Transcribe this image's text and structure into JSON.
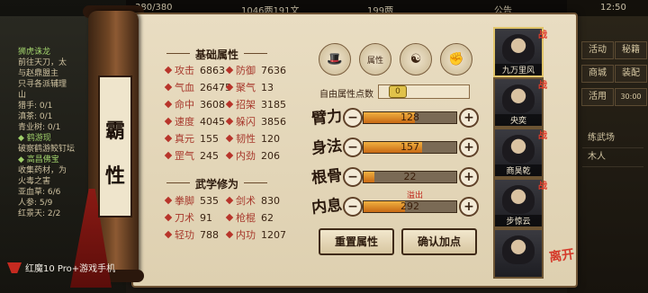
{
  "hud": {
    "stamina": "380/380",
    "copper": "1046两191文",
    "silver": "199两",
    "announce": "公告",
    "time": "12:50"
  },
  "quests": [
    {
      "title": "狮虎诛龙",
      "lines": [
        "前往天刀，太",
        "与赵鼎盟主",
        "只寻各派辅理",
        "山"
      ]
    },
    {
      "title": "",
      "lines": [
        "猎手: 0/1",
        "滇茶: 0/1",
        "青业树: 0/1"
      ]
    },
    {
      "title": "◆ 鹤游现",
      "lines": [
        "破察鹤游鲛钉坛"
      ]
    },
    {
      "title": "◆ 高昌佛宝",
      "lines": [
        "收集药材，为",
        "火毒之害"
      ]
    },
    {
      "title": "",
      "lines": [
        "亚血草: 6/6",
        "人参: 5/9",
        "红景天: 2/2"
      ]
    }
  ],
  "right_menu": [
    "活动",
    "秘籍",
    "商城",
    "装配",
    "活用"
  ],
  "right_menu_counts": [
    "",
    "",
    "",
    "",
    "30:00"
  ],
  "side_list": [
    "练武场",
    "木人"
  ],
  "character_name": [
    "霸",
    "性"
  ],
  "base_attr": {
    "title": "基础属性",
    "rows": [
      {
        "label": "攻击",
        "value": "6863"
      },
      {
        "label": "防御",
        "value": "7636"
      },
      {
        "label": "气血",
        "value": "26475"
      },
      {
        "label": "聚气",
        "value": "13"
      },
      {
        "label": "命中",
        "value": "3608"
      },
      {
        "label": "招架",
        "value": "3185"
      },
      {
        "label": "速度",
        "value": "4045"
      },
      {
        "label": "躲闪",
        "value": "3856"
      },
      {
        "label": "真元",
        "value": "155"
      },
      {
        "label": "韧性",
        "value": "120"
      },
      {
        "label": "罡气",
        "value": "245"
      },
      {
        "label": "内劲",
        "value": "206"
      }
    ]
  },
  "martial": {
    "title": "武学修为",
    "rows": [
      {
        "label": "拳脚",
        "value": "535"
      },
      {
        "label": "剑术",
        "value": "830"
      },
      {
        "label": "刀术",
        "value": "91"
      },
      {
        "label": "枪棍",
        "value": "62"
      },
      {
        "label": "轻功",
        "value": "788"
      },
      {
        "label": "内功",
        "value": "1207"
      }
    ]
  },
  "icons": [
    "hat-scholar-icon",
    "scroll-book-icon",
    "taichi-icon",
    "fist-icon"
  ],
  "icon_glyphs": [
    "🎩",
    "属性",
    "☯",
    "✊"
  ],
  "free_points": {
    "label": "自由属性点数",
    "value": "0"
  },
  "stats": [
    {
      "label": "臂力",
      "value": "128",
      "fill": 0.55,
      "overflow": ""
    },
    {
      "label": "身法",
      "value": "157",
      "fill": 0.63,
      "overflow": ""
    },
    {
      "label": "根骨",
      "value": "22",
      "fill": 0.12,
      "overflow": ""
    },
    {
      "label": "内息",
      "value": "292",
      "fill": 0.45,
      "overflow": "溢出"
    }
  ],
  "buttons": {
    "reset": "重置属性",
    "confirm": "确认加点"
  },
  "characters": [
    {
      "name": "九万里风",
      "tag": "战",
      "active": true
    },
    {
      "name": "央奕",
      "tag": "战",
      "active": false
    },
    {
      "name": "商昊乾",
      "tag": "战",
      "active": false
    },
    {
      "name": "步惊云",
      "tag": "战",
      "active": false
    },
    {
      "name": "",
      "tag": "",
      "active": false
    }
  ],
  "realm_tag": "离开",
  "watermark": "红魔10 Pro+游戏手机",
  "colors": {
    "label_red": "#a7382c",
    "bar_fill": "#e08a22",
    "accent_gold": "#e0c46a"
  }
}
